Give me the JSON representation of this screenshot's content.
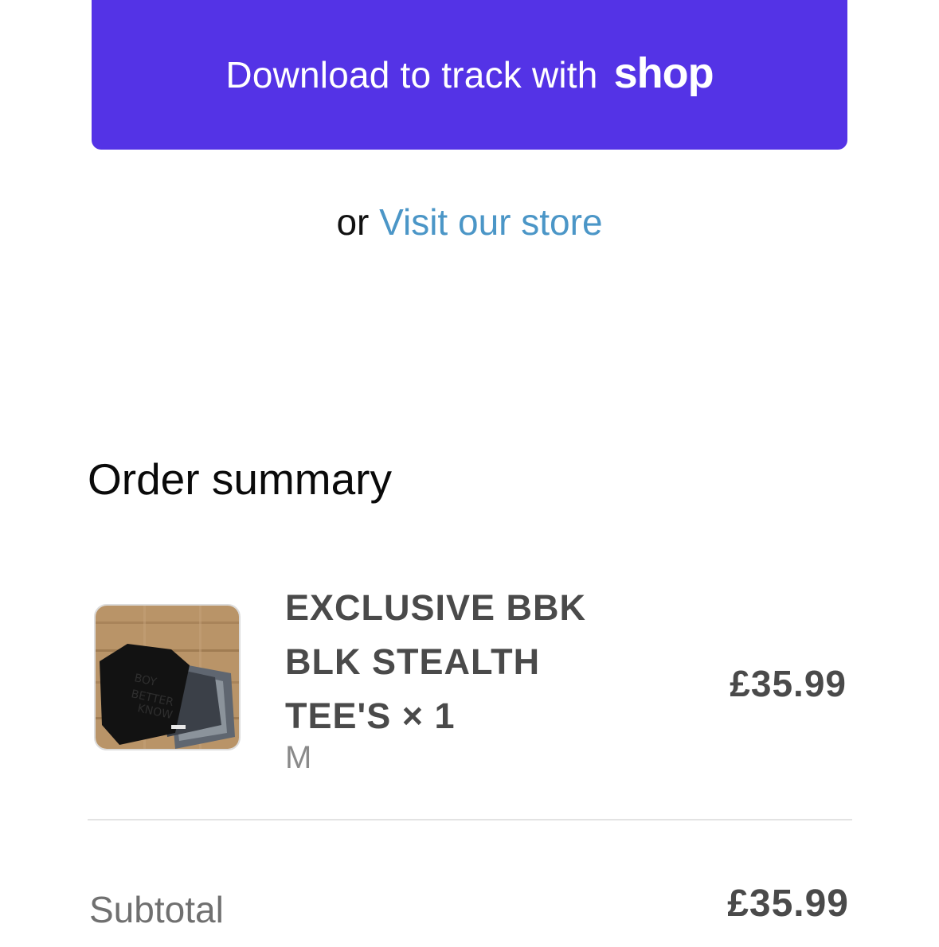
{
  "shop_button": {
    "label": "Download to track with",
    "logo_text": "shop",
    "color": "#5433e6"
  },
  "store_link": {
    "prefix": "or",
    "label": "Visit our store",
    "color": "#4b96c7"
  },
  "order_summary": {
    "title": "Order summary",
    "items": [
      {
        "title": "EXCLUSIVE BBK BLK STEALTH TEE'S × 1",
        "variant": "M",
        "price": "£35.99",
        "image_icon": "tshirt-product-photo"
      }
    ],
    "subtotal": {
      "label": "Subtotal",
      "value": "£35.99"
    }
  }
}
